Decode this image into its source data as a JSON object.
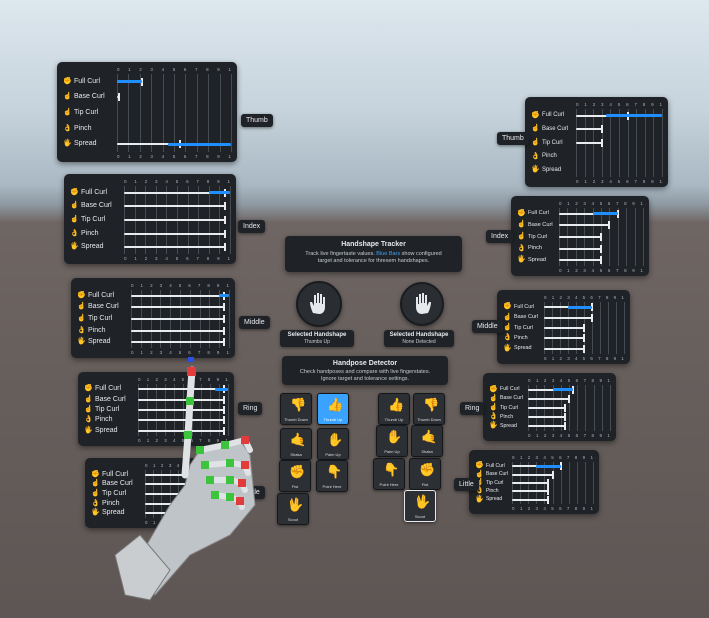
{
  "finger_rows": [
    "Full Curl",
    "Base Curl",
    "Tip Curl",
    "Pinch",
    "Spread"
  ],
  "scale_labels": [
    "0",
    "1",
    "2",
    "3",
    "4",
    "5",
    "6",
    "7",
    "8",
    "9",
    "1"
  ],
  "finger_tags": {
    "thumb": "Thumb",
    "index": "Index",
    "middle": "Middle",
    "ring": "Ring",
    "little": "Little"
  },
  "tracker": {
    "title": "Handshape Tracker",
    "desc_1": "Track live fingertaste values.",
    "desc_blue": "Blue Bars",
    "desc_2": "show configured",
    "desc_3": "target and tolerance for thresem handshapes."
  },
  "selected_left": {
    "label": "Selected Handshape",
    "value": "Thumbs Up"
  },
  "selected_right": {
    "label": "Selected Handshape",
    "value": "None Detected"
  },
  "detector": {
    "title": "Handpose Detector",
    "desc_1": "Check handposes and compare with live fingerstates.",
    "desc_2": "Ignore target and tolerance settings."
  },
  "left_poses": [
    {
      "label": "Thumb Down",
      "icon": "thumb-down-icon",
      "glyph": "👎"
    },
    {
      "label": "Thumb Up",
      "icon": "thumb-up-icon",
      "glyph": "👍"
    },
    {
      "label": "Shaka",
      "icon": "shaka-icon",
      "glyph": "🤙"
    },
    {
      "label": "Palm Up",
      "icon": "palm-up-icon",
      "glyph": "✋"
    },
    {
      "label": "Fist",
      "icon": "fist-icon",
      "glyph": "✊"
    },
    {
      "label": "Point Here",
      "icon": "point-here-icon",
      "glyph": "👇"
    },
    {
      "label": "Scoot",
      "icon": "scoot-icon",
      "glyph": "🖖"
    }
  ],
  "right_poses": [
    {
      "label": "Thumb Up",
      "icon": "thumb-up-icon",
      "glyph": "👍"
    },
    {
      "label": "Thumb Down",
      "icon": "thumb-down-icon",
      "glyph": "👎"
    },
    {
      "label": "Palm Up",
      "icon": "palm-up-icon",
      "glyph": "✋"
    },
    {
      "label": "Shaka",
      "icon": "shaka-icon",
      "glyph": "🤙"
    },
    {
      "label": "Point Here",
      "icon": "point-here-icon",
      "glyph": "👇"
    },
    {
      "label": "Fist",
      "icon": "fist-icon",
      "glyph": "✊"
    },
    {
      "label": "Scoot",
      "icon": "scoot-icon",
      "glyph": "🖖"
    }
  ],
  "left_values": {
    "thumb": {
      "full": 0.22,
      "base": 0.02,
      "tip": 0.0,
      "pinch": 0.0,
      "spread": 0.55,
      "fill": [
        0.0,
        0.22
      ],
      "spreadfill": [
        0.45,
        1.0
      ]
    },
    "index": {
      "full": 0.95,
      "base": 0.95,
      "tip": 0.95,
      "pinch": 0.95,
      "spread": 0.95,
      "fill": [
        0.8,
        1.0
      ]
    },
    "middle": {
      "full": 0.95,
      "base": 0.95,
      "tip": 0.95,
      "pinch": 0.95,
      "spread": 0.95,
      "fill": [
        0.9,
        1.0
      ]
    },
    "ring": {
      "full": 0.95,
      "base": 0.95,
      "tip": 0.95,
      "pinch": 0.95,
      "spread": 0.95,
      "fill": [
        0.85,
        1.0
      ]
    },
    "little": {
      "full": 0.95,
      "base": 0.95,
      "tip": 0.95,
      "pinch": 0.95,
      "spread": 0.95,
      "fill": [
        0.85,
        1.0
      ]
    }
  },
  "right_values": {
    "thumb": {
      "full": 0.6,
      "base": 0.3,
      "tip": 0.3,
      "pinch": 0.0,
      "spread": 0.0,
      "fill": [
        0.35,
        1.0
      ]
    },
    "index": {
      "full": 0.7,
      "base": 0.6,
      "tip": 0.5,
      "pinch": 0.5,
      "spread": 0.5,
      "fill": [
        0.4,
        0.7
      ]
    },
    "middle": {
      "full": 0.6,
      "base": 0.6,
      "tip": 0.5,
      "pinch": 0.5,
      "spread": 0.5,
      "fill": [
        0.3,
        0.6
      ]
    },
    "ring": {
      "full": 0.55,
      "base": 0.5,
      "tip": 0.45,
      "pinch": 0.45,
      "spread": 0.45,
      "fill": [
        0.3,
        0.55
      ]
    },
    "little": {
      "full": 0.6,
      "base": 0.5,
      "tip": 0.45,
      "pinch": 0.45,
      "spread": 0.45,
      "fill": [
        0.3,
        0.6
      ]
    }
  },
  "colors": {
    "accent": "#1f8fff",
    "panel": "#1f2327",
    "text": "#e6e9ec"
  }
}
